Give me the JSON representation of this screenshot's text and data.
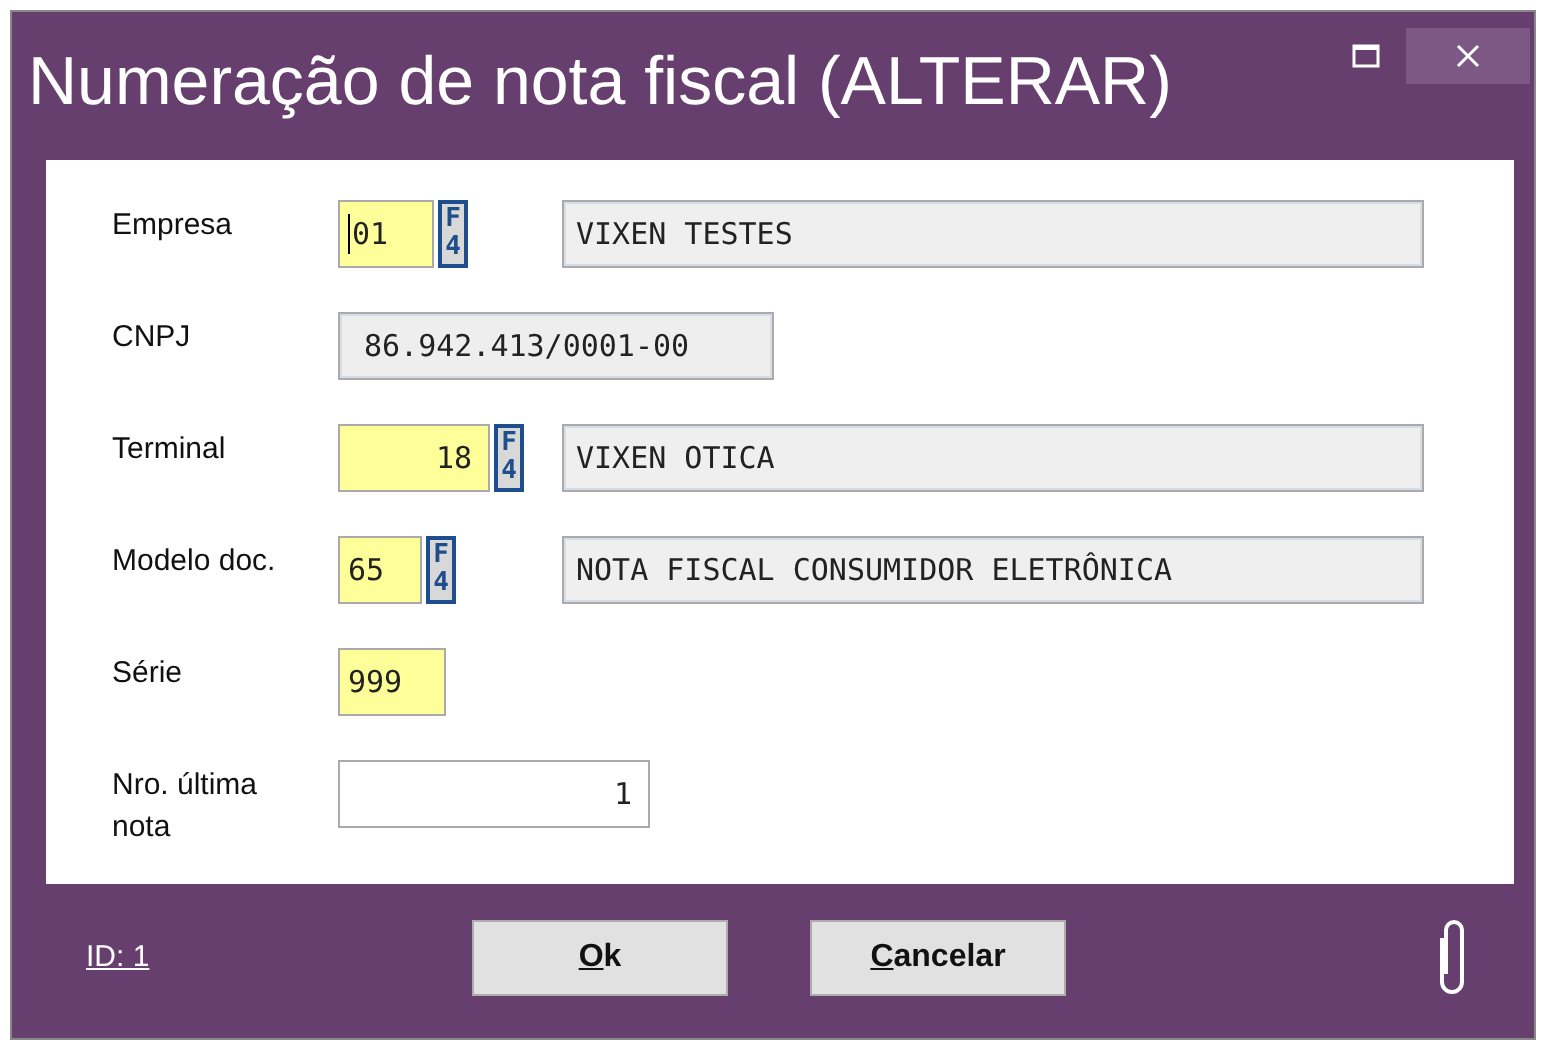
{
  "window": {
    "title": "Numeração de nota fiscal (ALTERAR)"
  },
  "fields": [
    {
      "label": "Empresa",
      "value": "01",
      "required": true,
      "right_aligned": false,
      "lookup": "F4",
      "description": "VIXEN TESTES",
      "focused": true
    },
    {
      "label": "CNPJ",
      "value": "86.942.413/0001-00",
      "required": false,
      "readonly": true,
      "right_aligned": false
    },
    {
      "label": "Terminal",
      "value": "18",
      "required": true,
      "right_aligned": true,
      "lookup": "F4",
      "description": "VIXEN OTICA"
    },
    {
      "label": "Modelo doc.",
      "value": "65",
      "required": true,
      "right_aligned": false,
      "lookup": "F4",
      "description": "NOTA FISCAL CONSUMIDOR ELETRÔNICA"
    },
    {
      "label": "Série",
      "value": "999",
      "required": true,
      "right_aligned": false
    },
    {
      "label": "Nro. última nota",
      "value": "1",
      "required": false,
      "right_aligned": true
    }
  ],
  "footer": {
    "id_link": "ID: 1",
    "buttons": [
      {
        "label": "Ok"
      },
      {
        "label": "Cancelar"
      }
    ]
  }
}
